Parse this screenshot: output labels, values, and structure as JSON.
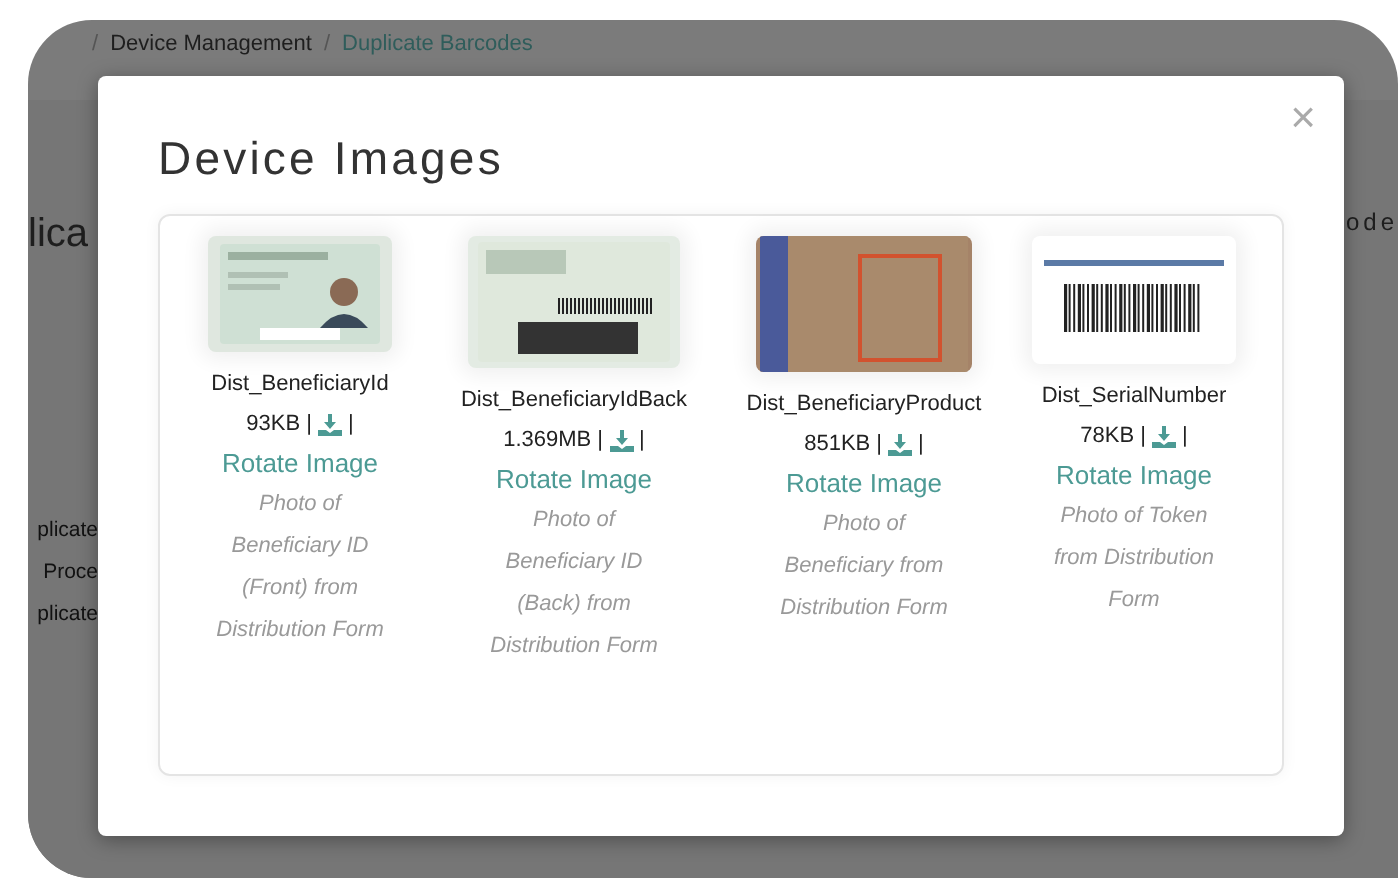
{
  "breadcrumb": {
    "separator": "/",
    "items": [
      {
        "label": "Device Management",
        "current": false
      },
      {
        "label": "Duplicate Barcodes",
        "current": true
      }
    ]
  },
  "background": {
    "heading": "lica",
    "right_heading": "ode",
    "rows": [
      "plicate",
      "Proce",
      "plicate"
    ]
  },
  "modal": {
    "title": "Device Images",
    "close": "×",
    "images": [
      {
        "kind": "id_front",
        "name": "Dist_BeneficiaryId",
        "size": "93KB |",
        "end": "|",
        "action": "Rotate Image",
        "description": "Photo of Beneficiary ID (Front) from Distribution Form"
      },
      {
        "kind": "id_back",
        "name": "Dist_BeneficiaryIdBack",
        "size": "1.369MB |",
        "end": "|",
        "action": "Rotate Image",
        "description": "Photo of Beneficiary ID (Back) from Distribution Form"
      },
      {
        "kind": "photo",
        "name": "Dist_BeneficiaryProduct",
        "size": "851KB |",
        "end": "|",
        "action": "Rotate Image",
        "description": "Photo of Beneficiary from Distribution Form"
      },
      {
        "kind": "barcode",
        "name": "Dist_SerialNumber",
        "size": "78KB |",
        "end": "|",
        "action": "Rotate Image",
        "description": "Photo of Token from Distribution Form"
      }
    ]
  }
}
